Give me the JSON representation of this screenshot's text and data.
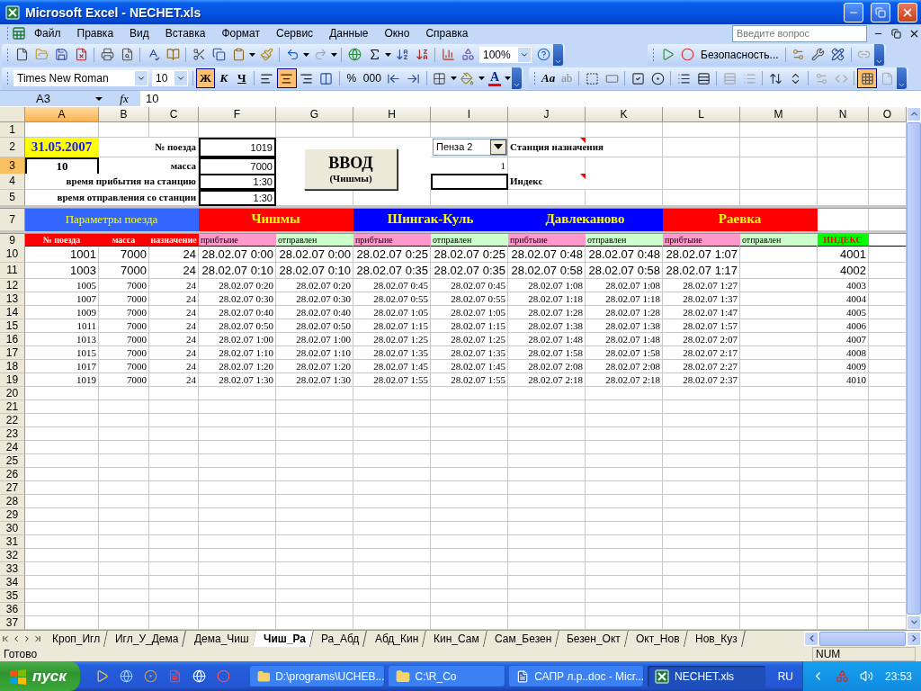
{
  "window": {
    "title": "Microsoft Excel - NECHET.xls"
  },
  "menu": [
    "Файл",
    "Правка",
    "Вид",
    "Вставка",
    "Формат",
    "Сервис",
    "Данные",
    "Окно",
    "Справка"
  ],
  "help_search": {
    "placeholder": "Введите вопрос"
  },
  "standard_toolbar": {
    "zoom": "100%"
  },
  "macro_toolbar": {
    "security": "Безопасность..."
  },
  "formatting_toolbar": {
    "font": "Times New Roman",
    "size": "10",
    "styles": [
      {
        "label": "Ж",
        "kind": "bold",
        "pressed": true
      },
      {
        "label": "К",
        "kind": "italic",
        "pressed": false
      },
      {
        "label": "Ч",
        "kind": "underline",
        "pressed": false
      }
    ],
    "alignments": [
      {
        "kind": "left",
        "pressed": false
      },
      {
        "kind": "center",
        "pressed": true
      },
      {
        "kind": "right",
        "pressed": false
      }
    ],
    "number_buttons": [
      "%",
      "000"
    ],
    "font_color_label": "A"
  },
  "forms_toolbar": {
    "label_tool": "Aa",
    "edit_box_tool": "ab",
    "grid_pressed": true
  },
  "formula_bar": {
    "name_box": "A3",
    "fx": "fx",
    "value": "10"
  },
  "columns": [
    {
      "label": "A",
      "selected": true
    },
    {
      "label": "B",
      "selected": false
    },
    {
      "label": "C",
      "selected": false
    },
    {
      "label": "F",
      "selected": false
    },
    {
      "label": "G",
      "selected": false
    },
    {
      "label": "H",
      "selected": false
    },
    {
      "label": "I",
      "selected": false
    },
    {
      "label": "J",
      "selected": false
    },
    {
      "label": "K",
      "selected": false
    },
    {
      "label": "L",
      "selected": false
    },
    {
      "label": "M",
      "selected": false
    },
    {
      "label": "N",
      "selected": false
    },
    {
      "label": "O",
      "selected": false
    }
  ],
  "row_headers": [
    {
      "label": "1",
      "selected": false
    },
    {
      "label": "2",
      "selected": false
    },
    {
      "label": "3",
      "selected": true
    },
    {
      "label": "4",
      "selected": false
    },
    {
      "label": "5",
      "selected": false
    },
    {
      "label": "7",
      "selected": false
    },
    {
      "label": "9",
      "selected": false
    },
    {
      "label": "10",
      "selected": false
    },
    {
      "label": "11",
      "selected": false
    },
    {
      "label": "12",
      "selected": false
    },
    {
      "label": "13",
      "selected": false
    },
    {
      "label": "14",
      "selected": false
    },
    {
      "label": "15",
      "selected": false
    },
    {
      "label": "16",
      "selected": false
    },
    {
      "label": "17",
      "selected": false
    },
    {
      "label": "18",
      "selected": false
    },
    {
      "label": "19",
      "selected": false
    },
    {
      "label": "20",
      "selected": false
    },
    {
      "label": "21",
      "selected": false
    },
    {
      "label": "22",
      "selected": false
    },
    {
      "label": "23",
      "selected": false
    },
    {
      "label": "24",
      "selected": false
    },
    {
      "label": "25",
      "selected": false
    },
    {
      "label": "26",
      "selected": false
    },
    {
      "label": "27",
      "selected": false
    },
    {
      "label": "28",
      "selected": false
    },
    {
      "label": "29",
      "selected": false
    },
    {
      "label": "30",
      "selected": false
    },
    {
      "label": "31",
      "selected": false
    },
    {
      "label": "32",
      "selected": false
    },
    {
      "label": "33",
      "selected": false
    },
    {
      "label": "34",
      "selected": false
    },
    {
      "label": "35",
      "selected": false
    },
    {
      "label": "36",
      "selected": false
    },
    {
      "label": "37",
      "selected": false
    }
  ],
  "info": {
    "date": "31.05.2007",
    "active_value": "10",
    "labels": [
      "№ поезда",
      "масса",
      "время прибытия на станцию",
      "время отправления со станции"
    ],
    "values": [
      "1019",
      "7000",
      "1:30",
      "1:30"
    ]
  },
  "enter_button": {
    "title": "ВВОД",
    "subtitle": "(Чишмы)"
  },
  "destination": {
    "value": "Пенза 2",
    "label": "Станция назначения",
    "number": "1",
    "index_label": "Индекс"
  },
  "parameters_header": "Параметры поезда",
  "stations": [
    {
      "name": "Чишмы",
      "color": "#ff0000"
    },
    {
      "name": "Шингак-Куль",
      "color": "#0000ff"
    },
    {
      "name": "Давлеканово",
      "color": "#0000ff"
    },
    {
      "name": "Раевка",
      "color": "#ff0000"
    }
  ],
  "param_columns": [
    "№ поезда",
    "масса",
    "назначение"
  ],
  "time_columns": [
    {
      "label": "прибтыие",
      "kind": "arrival"
    },
    {
      "label": "отправлен",
      "kind": "departure"
    },
    {
      "label": "прибтыие",
      "kind": "arrival"
    },
    {
      "label": "отправлен",
      "kind": "departure"
    },
    {
      "label": "прибтыие",
      "kind": "arrival"
    },
    {
      "label": "отправлен",
      "kind": "departure"
    },
    {
      "label": "прибтыие",
      "kind": "arrival"
    },
    {
      "label": "отправлен",
      "kind": "departure"
    }
  ],
  "index_header": "ИНДЕКС",
  "trains": [
    {
      "kind": "large",
      "number": "1001",
      "mass": "7000",
      "destination": "24",
      "times": [
        "28.02.07 0:00",
        "28.02.07 0:00",
        "28.02.07 0:25",
        "28.02.07 0:25",
        "28.02.07 0:48",
        "28.02.07 0:48",
        "28.02.07 1:07"
      ],
      "index": "4001"
    },
    {
      "kind": "large",
      "number": "1003",
      "mass": "7000",
      "destination": "24",
      "times": [
        "28.02.07 0:10",
        "28.02.07 0:10",
        "28.02.07 0:35",
        "28.02.07 0:35",
        "28.02.07 0:58",
        "28.02.07 0:58",
        "28.02.07 1:17"
      ],
      "index": "4002"
    },
    {
      "kind": "small",
      "number": "1005",
      "mass": "7000",
      "destination": "24",
      "times": [
        "28.02.07 0:20",
        "28.02.07 0:20",
        "28.02.07 0:45",
        "28.02.07 0:45",
        "28.02.07 1:08",
        "28.02.07 1:08",
        "28.02.07 1:27"
      ],
      "index": "4003"
    },
    {
      "kind": "small",
      "number": "1007",
      "mass": "7000",
      "destination": "24",
      "times": [
        "28.02.07 0:30",
        "28.02.07 0:30",
        "28.02.07 0:55",
        "28.02.07 0:55",
        "28.02.07 1:18",
        "28.02.07 1:18",
        "28.02.07 1:37"
      ],
      "index": "4004"
    },
    {
      "kind": "small",
      "number": "1009",
      "mass": "7000",
      "destination": "24",
      "times": [
        "28.02.07 0:40",
        "28.02.07 0:40",
        "28.02.07 1:05",
        "28.02.07 1:05",
        "28.02.07 1:28",
        "28.02.07 1:28",
        "28.02.07 1:47"
      ],
      "index": "4005"
    },
    {
      "kind": "small",
      "number": "1011",
      "mass": "7000",
      "destination": "24",
      "times": [
        "28.02.07 0:50",
        "28.02.07 0:50",
        "28.02.07 1:15",
        "28.02.07 1:15",
        "28.02.07 1:38",
        "28.02.07 1:38",
        "28.02.07 1:57"
      ],
      "index": "4006"
    },
    {
      "kind": "small",
      "number": "1013",
      "mass": "7000",
      "destination": "24",
      "times": [
        "28.02.07 1:00",
        "28.02.07 1:00",
        "28.02.07 1:25",
        "28.02.07 1:25",
        "28.02.07 1:48",
        "28.02.07 1:48",
        "28.02.07 2:07"
      ],
      "index": "4007"
    },
    {
      "kind": "small",
      "number": "1015",
      "mass": "7000",
      "destination": "24",
      "times": [
        "28.02.07 1:10",
        "28.02.07 1:10",
        "28.02.07 1:35",
        "28.02.07 1:35",
        "28.02.07 1:58",
        "28.02.07 1:58",
        "28.02.07 2:17"
      ],
      "index": "4008"
    },
    {
      "kind": "small",
      "number": "1017",
      "mass": "7000",
      "destination": "24",
      "times": [
        "28.02.07 1:20",
        "28.02.07 1:20",
        "28.02.07 1:45",
        "28.02.07 1:45",
        "28.02.07 2:08",
        "28.02.07 2:08",
        "28.02.07 2:27"
      ],
      "index": "4009"
    },
    {
      "kind": "small",
      "number": "1019",
      "mass": "7000",
      "destination": "24",
      "times": [
        "28.02.07 1:30",
        "28.02.07 1:30",
        "28.02.07 1:55",
        "28.02.07 1:55",
        "28.02.07 2:18",
        "28.02.07 2:18",
        "28.02.07 2:37"
      ],
      "index": "4010"
    }
  ],
  "sheet_tabs": [
    {
      "label": "Кроп_Игл",
      "selected": false
    },
    {
      "label": "Игл_У_Дема",
      "selected": false
    },
    {
      "label": "Дема_Чиш",
      "selected": false
    },
    {
      "label": "Чиш_Ра",
      "selected": true
    },
    {
      "label": "Ра_Абд",
      "selected": false
    },
    {
      "label": "Абд_Кин",
      "selected": false
    },
    {
      "label": "Кин_Сам",
      "selected": false
    },
    {
      "label": "Сам_Безен",
      "selected": false
    },
    {
      "label": "Безен_Окт",
      "selected": false
    },
    {
      "label": "Окт_Нов",
      "selected": false
    },
    {
      "label": "Нов_Куз",
      "selected": false
    }
  ],
  "status": {
    "text": "Готово",
    "num": "NUM"
  },
  "taskbar": {
    "start": "пуск",
    "tasks": [
      {
        "label": "D:\\programs\\UCHEB...",
        "kind": "folder",
        "selected": false
      },
      {
        "label": "C:\\R_Co",
        "kind": "folder",
        "selected": false
      },
      {
        "label": "САПР л.р..doc - Micr...",
        "kind": "word",
        "selected": false
      },
      {
        "label": "NECHET.xls",
        "kind": "excel",
        "selected": true
      }
    ],
    "language": "RU",
    "clock": "23:53"
  }
}
